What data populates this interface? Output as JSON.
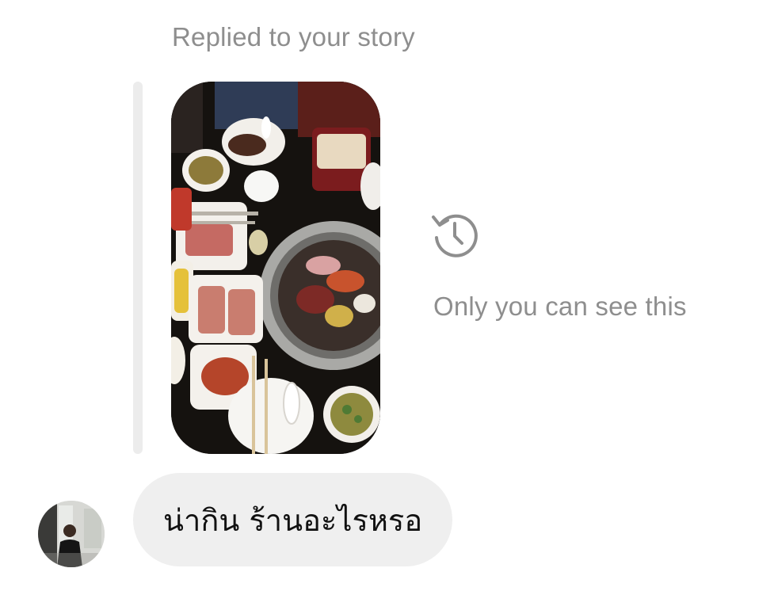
{
  "story_reply": {
    "header": "Replied to your story",
    "privacy_note": "Only you can see this",
    "expired_icon": "history-clock-icon",
    "thumbnail": "story-thumbnail-korean-bbq-table"
  },
  "message": {
    "text": "น่ากิน ร้านอะไรหรอ",
    "sender_avatar": "avatar-person-in-black-shirt"
  },
  "colors": {
    "secondary_text": "#8e8e8e",
    "bubble_background": "#efefef",
    "quote_bar": "#ececec",
    "message_text": "#111111"
  }
}
